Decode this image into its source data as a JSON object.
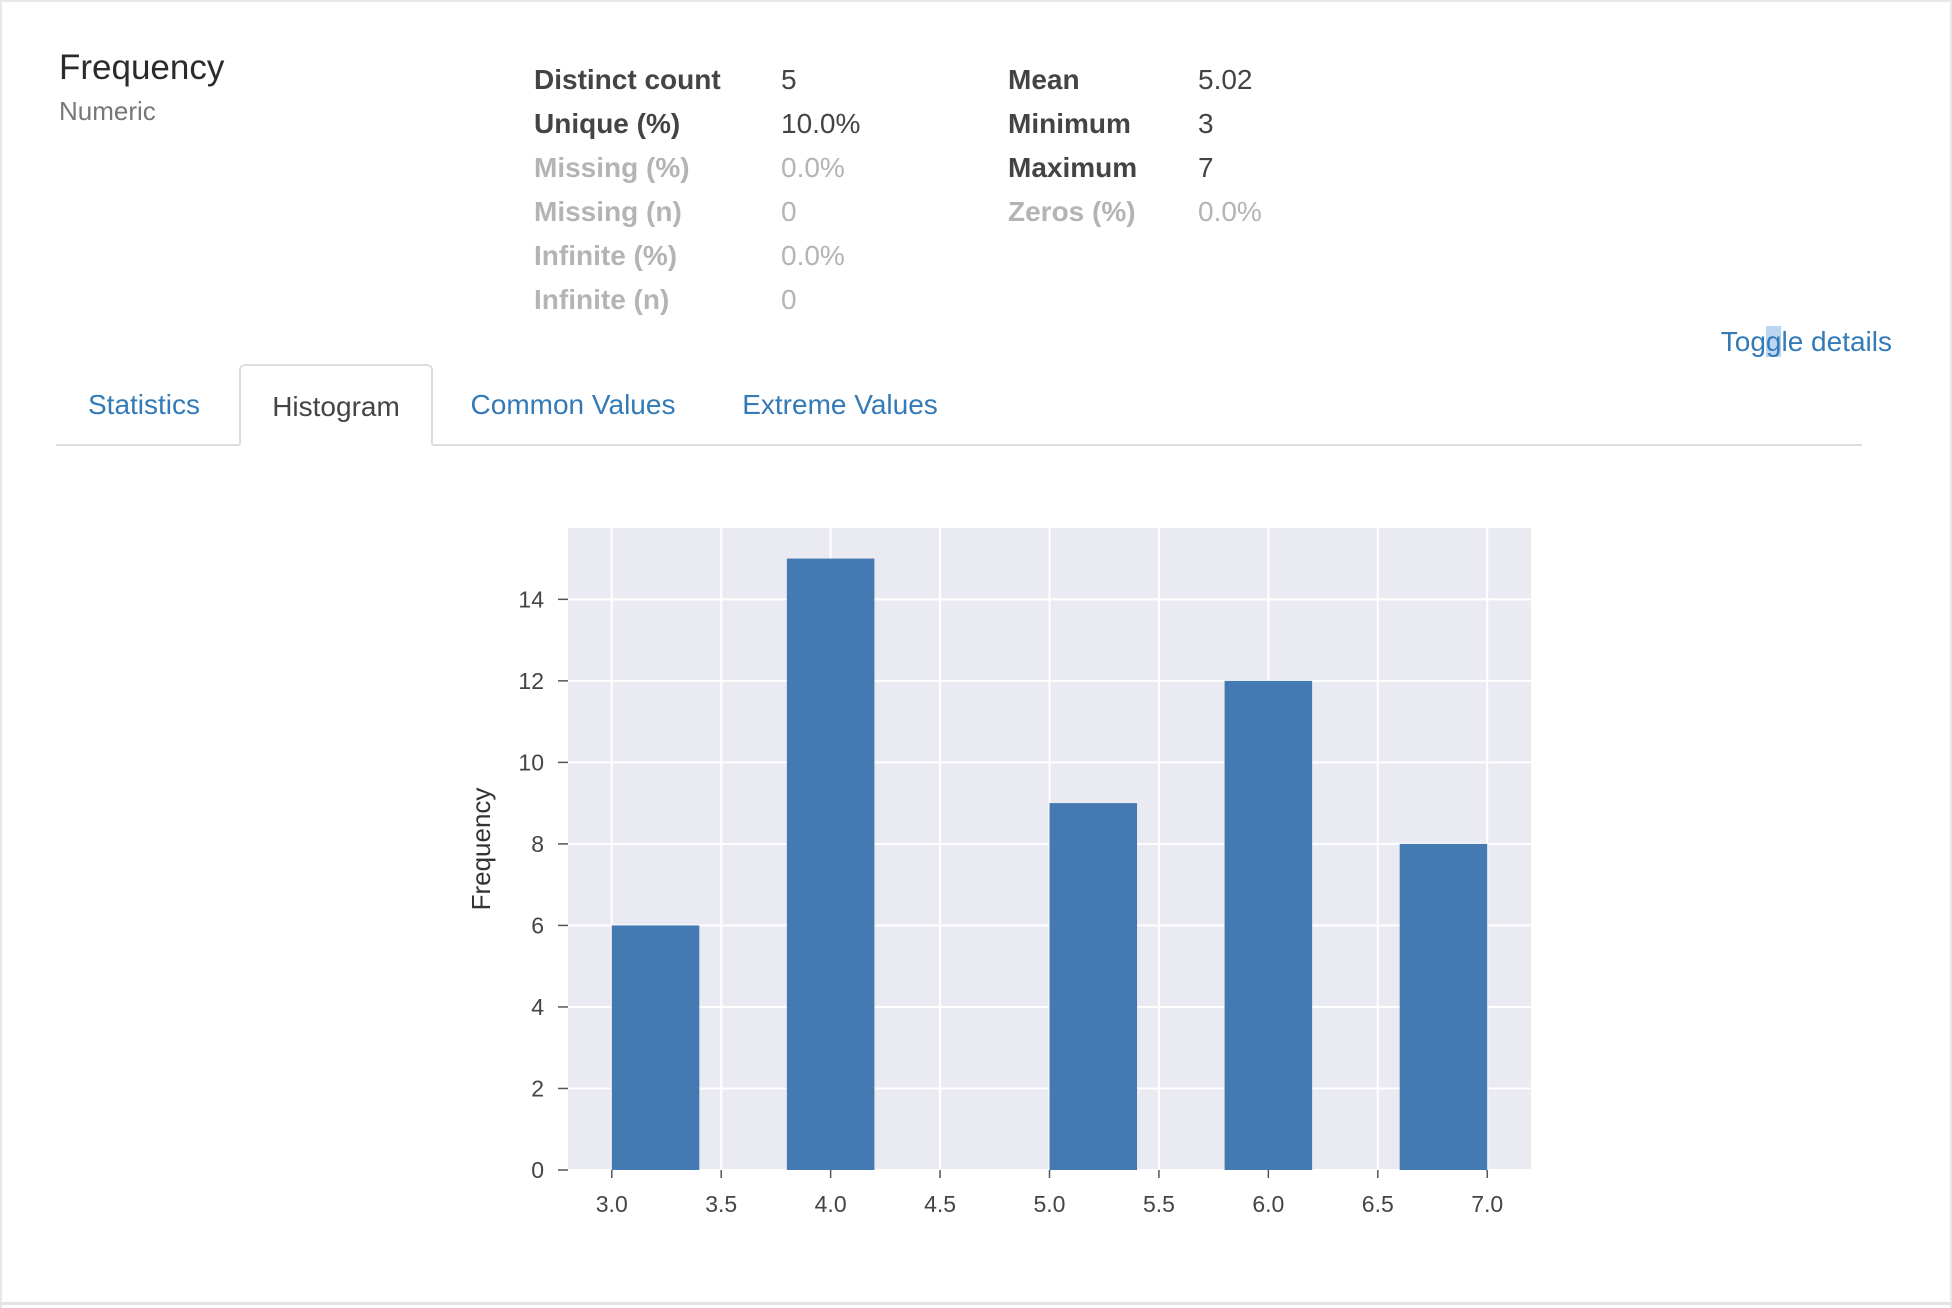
{
  "variable": {
    "name": "Frequency",
    "type": "Numeric"
  },
  "stats_left": [
    {
      "label": "Distinct count",
      "value": "5",
      "muted": false
    },
    {
      "label": "Unique (%)",
      "value": "10.0%",
      "muted": false
    },
    {
      "label": "Missing (%)",
      "value": "0.0%",
      "muted": true
    },
    {
      "label": "Missing (n)",
      "value": "0",
      "muted": true
    },
    {
      "label": "Infinite (%)",
      "value": "0.0%",
      "muted": true
    },
    {
      "label": "Infinite (n)",
      "value": "0",
      "muted": true
    }
  ],
  "stats_right": [
    {
      "label": "Mean",
      "value": "5.02",
      "muted": false
    },
    {
      "label": "Minimum",
      "value": "3",
      "muted": false
    },
    {
      "label": "Maximum",
      "value": "7",
      "muted": false
    },
    {
      "label": "Zeros (%)",
      "value": "0.0%",
      "muted": true
    }
  ],
  "toggle_details": {
    "pre": "Tog",
    "highlight": "g",
    "post": "le details"
  },
  "tabs": [
    {
      "label": "Statistics",
      "active": false
    },
    {
      "label": "Histogram",
      "active": true
    },
    {
      "label": "Common Values",
      "active": false
    },
    {
      "label": "Extreme Values",
      "active": false
    }
  ],
  "colors": {
    "link": "#337ab7",
    "bar": "#4479b2",
    "plot_bg": "#eaeaf2",
    "grid": "#ffffff"
  },
  "chart_data": {
    "type": "bar",
    "ylabel": "Frequency",
    "xlabel": "",
    "title": "",
    "xlim": [
      2.8,
      7.2
    ],
    "ylim": [
      0,
      15.75
    ],
    "x_ticks": [
      "3.0",
      "3.5",
      "4.0",
      "4.5",
      "5.0",
      "5.5",
      "6.0",
      "6.5",
      "7.0"
    ],
    "y_ticks": [
      "0",
      "2",
      "4",
      "6",
      "8",
      "10",
      "12",
      "14"
    ],
    "grid": true,
    "bins": [
      {
        "x_start": 3.0,
        "x_end": 3.4,
        "value": 6
      },
      {
        "x_start": 3.8,
        "x_end": 4.2,
        "value": 15
      },
      {
        "x_start": 5.0,
        "x_end": 5.4,
        "value": 9
      },
      {
        "x_start": 5.8,
        "x_end": 6.2,
        "value": 12
      },
      {
        "x_start": 6.6,
        "x_end": 7.0,
        "value": 8
      }
    ]
  }
}
